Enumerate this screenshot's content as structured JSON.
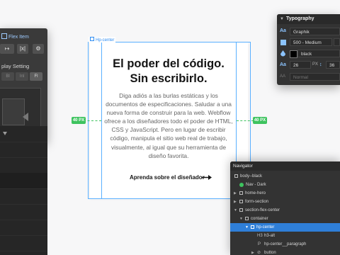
{
  "left_panel": {
    "flex_item_label": "Flex Item",
    "buttons": [
      "↦",
      "|x|",
      "⚙"
    ],
    "display_label": "play Setting",
    "display_options": [
      "Bl",
      "Inl",
      "Fl"
    ],
    "dots": "•••"
  },
  "selection": {
    "label": "Hp-center",
    "margin_left": "40 PX",
    "margin_right": "40 PX"
  },
  "hero": {
    "title_line1": "El poder del código.",
    "title_line2": "Sin escribirlo.",
    "body": "Diga adiós a las burlas estáticas y los documentos de especificaciones. Saludar a una nueva forma de construir para la web. Webflow ofrece a los diseñadores todo el poder de HTML, CSS y JavaScript. Pero en lugar de escribir código, manipula el sitio web real de trabajo, visualmente, al igual que su herramienta de diseño favorita.",
    "link": "Aprenda sobre el diseñador"
  },
  "typography": {
    "title": "Typography",
    "font": "Graphik",
    "weight": "500 - Medium",
    "color": "black",
    "size": "26",
    "size_unit": "PX",
    "line_height": "36",
    "style": "Normal"
  },
  "navigator": {
    "title": "Navigator",
    "items": [
      {
        "label": "body--black",
        "icon": "box"
      },
      {
        "label": "Nav - Dark",
        "icon": "component"
      },
      {
        "label": "home-hero",
        "icon": "box"
      },
      {
        "label": "form-section",
        "icon": "box"
      },
      {
        "label": "section-flex-center",
        "icon": "box"
      },
      {
        "label": "container",
        "icon": "box"
      },
      {
        "label": "hp-center",
        "icon": "box"
      },
      {
        "label": "h3-alt",
        "icon": "heading"
      },
      {
        "label": "hp-center__paragraph",
        "icon": "paragraph"
      },
      {
        "label": "button",
        "icon": "link"
      }
    ]
  },
  "colors": {
    "selection_blue": "#5ab0ff",
    "margin_green": "#3ec35f",
    "panel_dark": "#333333",
    "nav_selected": "#2f7fd8"
  }
}
